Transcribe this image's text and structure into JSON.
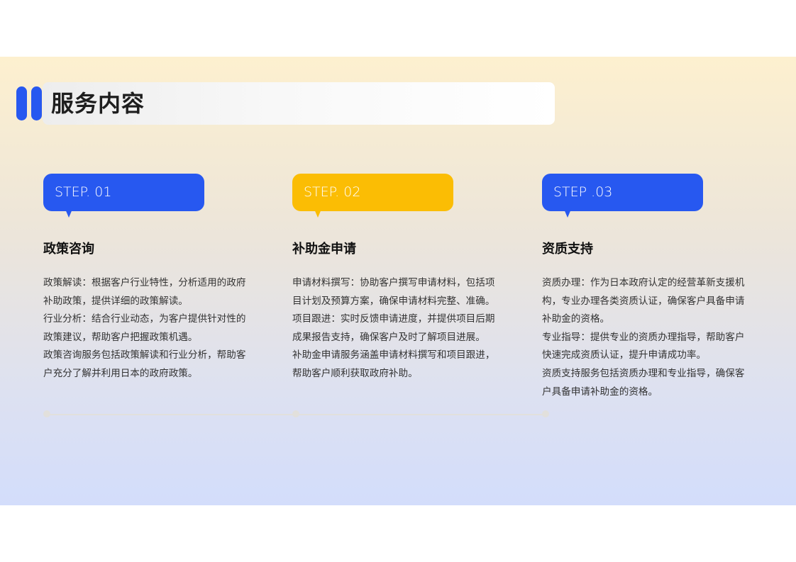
{
  "header": {
    "title": "服务内容"
  },
  "colors": {
    "blue": "#2758f0",
    "yellow": "#fbbd04"
  },
  "steps": [
    {
      "label": "STEP. 01",
      "color": "#2758f0",
      "heading": "政策咨询",
      "paragraphs": [
        "政策解读：根据客户行业特性，分析适用的政府补助政策，提供详细的政策解读。",
        "行业分析：结合行业动态，为客户提供针对性的政策建议，帮助客户把握政策机遇。",
        "政策咨询服务包括政策解读和行业分析，帮助客户充分了解并利用日本的政府政策。"
      ]
    },
    {
      "label": "STEP. 02",
      "color": "#fbbd04",
      "heading": "补助金申请",
      "paragraphs": [
        "申请材料撰写：协助客户撰写申请材料，包括项目计划及预算方案，确保申请材料完整、准确。",
        "项目跟进：实时反馈申请进度，并提供项目后期成果报告支持，确保客户及时了解项目进展。",
        "补助金申请服务涵盖申请材料撰写和项目跟进，帮助客户顺利获取政府补助。"
      ]
    },
    {
      "label": "STEP .03",
      "color": "#2758f0",
      "heading": "资质支持",
      "paragraphs": [
        "资质办理：作为日本政府认定的经营革新支援机构，专业办理各类资质认证，确保客户具备申请补助金的资格。",
        "专业指导：提供专业的资质办理指导，帮助客户快速完成资质认证，提升申请成功率。",
        "资质支持服务包括资质办理和专业指导，确保客户具备申请补助金的资格。"
      ]
    }
  ]
}
